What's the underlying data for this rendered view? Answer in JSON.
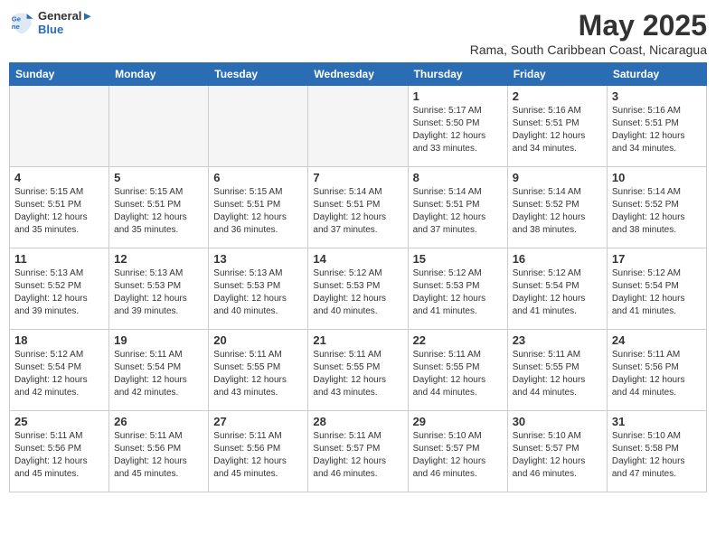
{
  "header": {
    "logo_line1": "General",
    "logo_line2": "Blue",
    "month_title": "May 2025",
    "location": "Rama, South Caribbean Coast, Nicaragua"
  },
  "weekdays": [
    "Sunday",
    "Monday",
    "Tuesday",
    "Wednesday",
    "Thursday",
    "Friday",
    "Saturday"
  ],
  "weeks": [
    [
      {
        "day": "",
        "info": "",
        "empty": true
      },
      {
        "day": "",
        "info": "",
        "empty": true
      },
      {
        "day": "",
        "info": "",
        "empty": true
      },
      {
        "day": "",
        "info": "",
        "empty": true
      },
      {
        "day": "1",
        "info": "Sunrise: 5:17 AM\nSunset: 5:50 PM\nDaylight: 12 hours\nand 33 minutes."
      },
      {
        "day": "2",
        "info": "Sunrise: 5:16 AM\nSunset: 5:51 PM\nDaylight: 12 hours\nand 34 minutes."
      },
      {
        "day": "3",
        "info": "Sunrise: 5:16 AM\nSunset: 5:51 PM\nDaylight: 12 hours\nand 34 minutes."
      }
    ],
    [
      {
        "day": "4",
        "info": "Sunrise: 5:15 AM\nSunset: 5:51 PM\nDaylight: 12 hours\nand 35 minutes."
      },
      {
        "day": "5",
        "info": "Sunrise: 5:15 AM\nSunset: 5:51 PM\nDaylight: 12 hours\nand 35 minutes."
      },
      {
        "day": "6",
        "info": "Sunrise: 5:15 AM\nSunset: 5:51 PM\nDaylight: 12 hours\nand 36 minutes."
      },
      {
        "day": "7",
        "info": "Sunrise: 5:14 AM\nSunset: 5:51 PM\nDaylight: 12 hours\nand 37 minutes."
      },
      {
        "day": "8",
        "info": "Sunrise: 5:14 AM\nSunset: 5:51 PM\nDaylight: 12 hours\nand 37 minutes."
      },
      {
        "day": "9",
        "info": "Sunrise: 5:14 AM\nSunset: 5:52 PM\nDaylight: 12 hours\nand 38 minutes."
      },
      {
        "day": "10",
        "info": "Sunrise: 5:14 AM\nSunset: 5:52 PM\nDaylight: 12 hours\nand 38 minutes."
      }
    ],
    [
      {
        "day": "11",
        "info": "Sunrise: 5:13 AM\nSunset: 5:52 PM\nDaylight: 12 hours\nand 39 minutes."
      },
      {
        "day": "12",
        "info": "Sunrise: 5:13 AM\nSunset: 5:53 PM\nDaylight: 12 hours\nand 39 minutes."
      },
      {
        "day": "13",
        "info": "Sunrise: 5:13 AM\nSunset: 5:53 PM\nDaylight: 12 hours\nand 40 minutes."
      },
      {
        "day": "14",
        "info": "Sunrise: 5:12 AM\nSunset: 5:53 PM\nDaylight: 12 hours\nand 40 minutes."
      },
      {
        "day": "15",
        "info": "Sunrise: 5:12 AM\nSunset: 5:53 PM\nDaylight: 12 hours\nand 41 minutes."
      },
      {
        "day": "16",
        "info": "Sunrise: 5:12 AM\nSunset: 5:54 PM\nDaylight: 12 hours\nand 41 minutes."
      },
      {
        "day": "17",
        "info": "Sunrise: 5:12 AM\nSunset: 5:54 PM\nDaylight: 12 hours\nand 41 minutes."
      }
    ],
    [
      {
        "day": "18",
        "info": "Sunrise: 5:12 AM\nSunset: 5:54 PM\nDaylight: 12 hours\nand 42 minutes."
      },
      {
        "day": "19",
        "info": "Sunrise: 5:11 AM\nSunset: 5:54 PM\nDaylight: 12 hours\nand 42 minutes."
      },
      {
        "day": "20",
        "info": "Sunrise: 5:11 AM\nSunset: 5:55 PM\nDaylight: 12 hours\nand 43 minutes."
      },
      {
        "day": "21",
        "info": "Sunrise: 5:11 AM\nSunset: 5:55 PM\nDaylight: 12 hours\nand 43 minutes."
      },
      {
        "day": "22",
        "info": "Sunrise: 5:11 AM\nSunset: 5:55 PM\nDaylight: 12 hours\nand 44 minutes."
      },
      {
        "day": "23",
        "info": "Sunrise: 5:11 AM\nSunset: 5:55 PM\nDaylight: 12 hours\nand 44 minutes."
      },
      {
        "day": "24",
        "info": "Sunrise: 5:11 AM\nSunset: 5:56 PM\nDaylight: 12 hours\nand 44 minutes."
      }
    ],
    [
      {
        "day": "25",
        "info": "Sunrise: 5:11 AM\nSunset: 5:56 PM\nDaylight: 12 hours\nand 45 minutes."
      },
      {
        "day": "26",
        "info": "Sunrise: 5:11 AM\nSunset: 5:56 PM\nDaylight: 12 hours\nand 45 minutes."
      },
      {
        "day": "27",
        "info": "Sunrise: 5:11 AM\nSunset: 5:56 PM\nDaylight: 12 hours\nand 45 minutes."
      },
      {
        "day": "28",
        "info": "Sunrise: 5:11 AM\nSunset: 5:57 PM\nDaylight: 12 hours\nand 46 minutes."
      },
      {
        "day": "29",
        "info": "Sunrise: 5:10 AM\nSunset: 5:57 PM\nDaylight: 12 hours\nand 46 minutes."
      },
      {
        "day": "30",
        "info": "Sunrise: 5:10 AM\nSunset: 5:57 PM\nDaylight: 12 hours\nand 46 minutes."
      },
      {
        "day": "31",
        "info": "Sunrise: 5:10 AM\nSunset: 5:58 PM\nDaylight: 12 hours\nand 47 minutes."
      }
    ]
  ]
}
